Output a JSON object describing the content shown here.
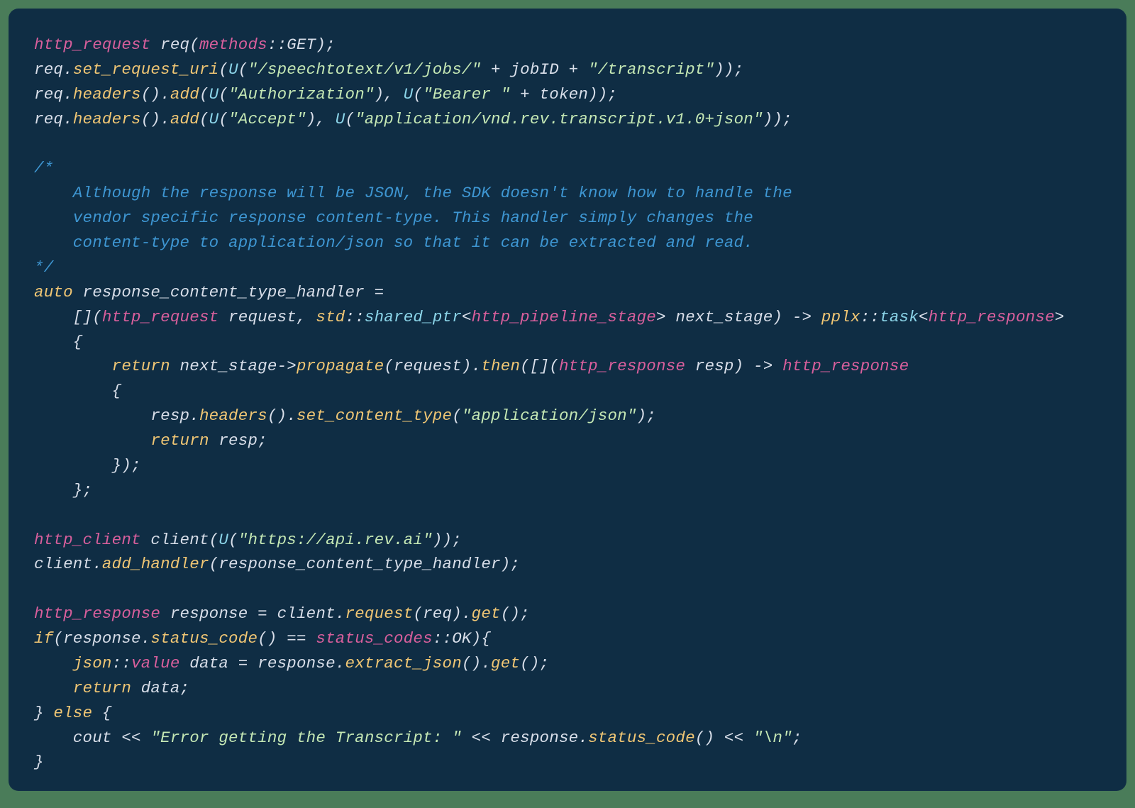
{
  "code": {
    "l1": {
      "a": "http_request",
      "b": " req(",
      "c": "methods",
      "d": "::GET);"
    },
    "l2": {
      "a": "req.",
      "b": "set_request_uri",
      "c": "(",
      "d": "U",
      "e": "(",
      "f": "\"/speechtotext/v1/jobs/\"",
      "g": " + jobID + ",
      "h": "\"/transcript\"",
      "i": "));"
    },
    "l3": {
      "a": "req.",
      "b": "headers",
      "c": "().",
      "d": "add",
      "e": "(",
      "f": "U",
      "g": "(",
      "h": "\"Authorization\"",
      "i": "), ",
      "j": "U",
      "k": "(",
      "l": "\"Bearer \"",
      "m": " + token));"
    },
    "l4": {
      "a": "req.",
      "b": "headers",
      "c": "().",
      "d": "add",
      "e": "(",
      "f": "U",
      "g": "(",
      "h": "\"Accept\"",
      "i": "), ",
      "j": "U",
      "k": "(",
      "l": "\"application/vnd.rev.transcript.v1.0+json\"",
      "m": "));"
    },
    "c1": "/*",
    "c2": "    Although the response will be JSON, the SDK doesn't know how to handle the",
    "c3": "    vendor specific response content-type. This handler simply changes the",
    "c4": "    content-type to application/json so that it can be extracted and read.",
    "c5": "*/",
    "l5": {
      "a": "auto",
      "b": " response_content_type_handler ="
    },
    "l6": {
      "a": "    [](",
      "b": "http_request",
      "c": " request, ",
      "d": "std",
      "e": "::",
      "f": "shared_ptr",
      "g": "<",
      "h": "http_pipeline_stage",
      "i": "> next_stage) -> ",
      "j": "pplx",
      "k": "::",
      "l": "task",
      "m": "<",
      "n": "http_response",
      "o": ">"
    },
    "l7": "    {",
    "l8": {
      "a": "        ",
      "b": "return",
      "c": " next_stage->",
      "d": "propagate",
      "e": "(request).",
      "f": "then",
      "g": "([](",
      "h": "http_response",
      "i": " resp) -> ",
      "j": "http_response"
    },
    "l9": "        {",
    "l10": {
      "a": "            resp.",
      "b": "headers",
      "c": "().",
      "d": "set_content_type",
      "e": "(",
      "f": "\"application/json\"",
      "g": ");"
    },
    "l11": {
      "a": "            ",
      "b": "return",
      "c": " resp;"
    },
    "l12": "        });",
    "l13": "    };",
    "l14": {
      "a": "http_client",
      "b": " client(",
      "c": "U",
      "d": "(",
      "e": "\"https://api.rev.ai\"",
      "f": "));"
    },
    "l15": {
      "a": "client.",
      "b": "add_handler",
      "c": "(response_content_type_handler);"
    },
    "l16": {
      "a": "http_response",
      "b": " response = client.",
      "c": "request",
      "d": "(req).",
      "e": "get",
      "f": "();"
    },
    "l17": {
      "a": "if",
      "b": "(response.",
      "c": "status_code",
      "d": "() == ",
      "e": "status_codes",
      "f": "::OK){"
    },
    "l18": {
      "a": "    ",
      "b": "json",
      "c": "::",
      "d": "value",
      "e": " data = response.",
      "f": "extract_json",
      "g": "().",
      "h": "get",
      "i": "();"
    },
    "l19": {
      "a": "    ",
      "b": "return",
      "c": " data;"
    },
    "l20": {
      "a": "} ",
      "b": "else",
      "c": " {"
    },
    "l21": {
      "a": "    cout << ",
      "b": "\"Error getting the Transcript: \"",
      "c": " << response.",
      "d": "status_code",
      "e": "() << ",
      "f": "\"\\n\"",
      "g": ";"
    },
    "l22": "}"
  }
}
